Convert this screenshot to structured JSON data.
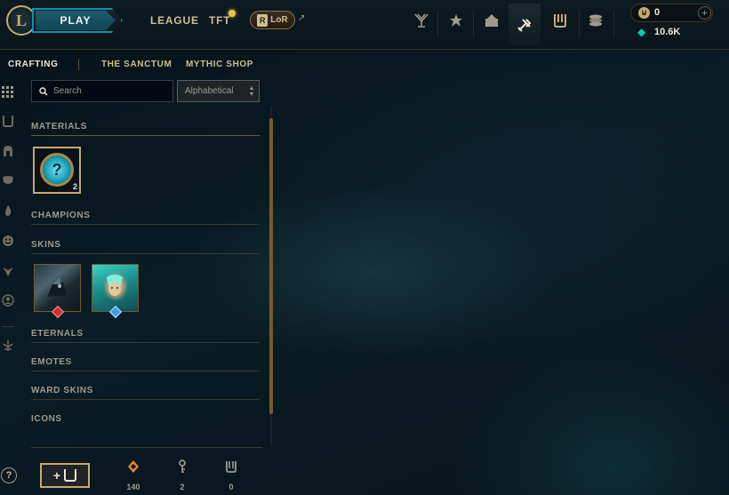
{
  "topbar": {
    "play_label": "PLAY",
    "nav": [
      "LEAGUE",
      "TFT"
    ],
    "lor_label": "LoR",
    "rp": "0",
    "blue_essence": "10.6K"
  },
  "subnav": [
    "CRAFTING",
    "THE SANCTUM",
    "MYTHIC SHOP"
  ],
  "search": {
    "placeholder": "Search"
  },
  "sort": {
    "value": "Alphabetical"
  },
  "categories": {
    "materials": "MATERIALS",
    "champions": "CHAMPIONS",
    "skins": "SKINS",
    "eternals": "ETERNALS",
    "emotes": "EMOTES",
    "ward_skins": "WARD SKINS",
    "icons": "ICONS"
  },
  "materials": [
    {
      "icon": "mystery-orb-icon",
      "count": "2"
    }
  ],
  "skins": [
    {
      "icon": "dark-skin-icon",
      "gem": "red"
    },
    {
      "icon": "teal-skin-icon",
      "gem": "blue"
    }
  ],
  "footer": {
    "orange_essence": "140",
    "keys": "2",
    "chests": "0"
  },
  "colors": {
    "gold": "#c8aa6e",
    "teal": "#0397ab",
    "background": "#010a13"
  }
}
